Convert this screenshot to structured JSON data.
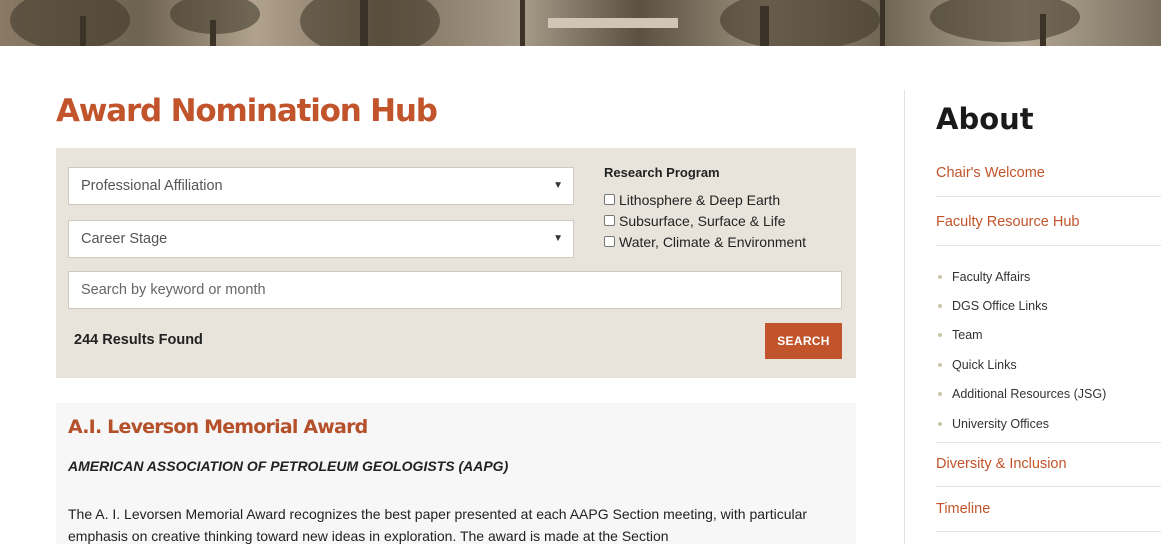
{
  "page": {
    "title": "Award Nomination Hub"
  },
  "filters": {
    "affiliation": {
      "value": "Professional Affiliation"
    },
    "career_stage": {
      "value": "Career Stage"
    },
    "research_program": {
      "title": "Research Program",
      "options": [
        "Lithosphere & Deep Earth",
        "Subsurface, Surface & Life",
        "Water, Climate & Environment"
      ]
    },
    "search": {
      "placeholder": "Search by keyword or month",
      "button_label": "SEARCH"
    },
    "results_text": "244 Results Found"
  },
  "results": [
    {
      "title": "A.I. Leverson Memorial Award",
      "organization": "AMERICAN ASSOCIATION OF PETROLEUM GEOLOGISTS (AAPG)",
      "description": "The A. I. Levorsen Memorial Award recognizes the best paper presented at each AAPG Section meeting, with particular emphasis on creative thinking toward new ideas in exploration. The award is made at the Section"
    }
  ],
  "sidebar": {
    "title": "About",
    "links": [
      "Chair's Welcome",
      "Faculty Resource Hub"
    ],
    "sub_items": [
      "Faculty Affairs",
      "DGS Office Links",
      "Team",
      "Quick Links",
      "Additional Resources (JSG)",
      "University Offices"
    ],
    "bottom_links": [
      "Diversity & Inclusion",
      "Timeline"
    ]
  },
  "colors": {
    "accent": "#c2542b",
    "panel": "#e8e4dc"
  }
}
